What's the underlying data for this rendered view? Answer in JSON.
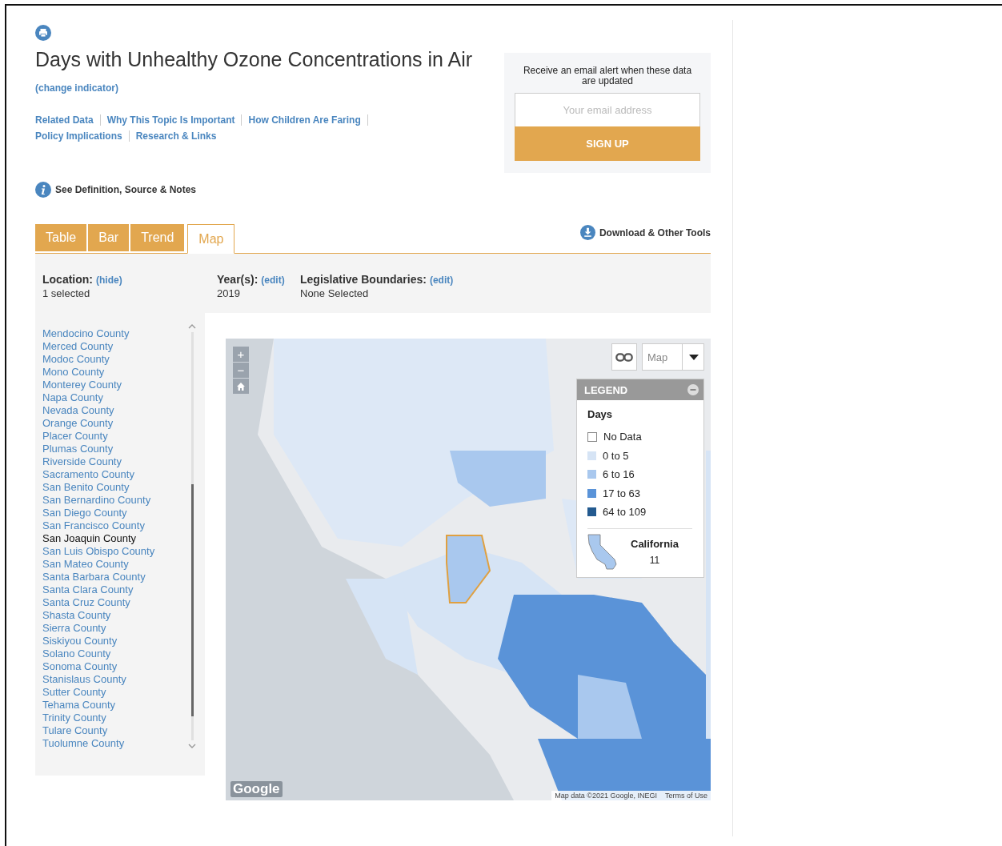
{
  "page": {
    "title": "Days with Unhealthy Ozone Concentrations in Air",
    "change_link": "(change indicator)",
    "nav_links": [
      "Related Data",
      "Why This Topic Is Important",
      "How Children Are Faring",
      "Policy Implications",
      "Research & Links"
    ],
    "definition_link": "See Definition, Source & Notes"
  },
  "alert_box": {
    "text": "Receive an email alert when these data are updated",
    "email": {
      "placeholder": "Your email address"
    },
    "button": "SIGN UP"
  },
  "tabs": [
    {
      "label": "Table",
      "selected": false
    },
    {
      "label": "Bar",
      "selected": false
    },
    {
      "label": "Trend",
      "selected": false
    },
    {
      "label": "Map",
      "selected": true
    }
  ],
  "tools_link": "Download & Other Tools",
  "filters": [
    {
      "label": "Location:",
      "action": "(hide)",
      "value": "1 selected"
    },
    {
      "label": "Year(s):",
      "action": "(edit)",
      "value": "2019"
    },
    {
      "label": "Legislative Boundaries:",
      "action": "(edit)",
      "value": "None Selected"
    }
  ],
  "locations": [
    {
      "name": "Mendocino County",
      "selected": false
    },
    {
      "name": "Merced County",
      "selected": false
    },
    {
      "name": "Modoc County",
      "selected": false
    },
    {
      "name": "Mono County",
      "selected": false
    },
    {
      "name": "Monterey County",
      "selected": false
    },
    {
      "name": "Napa County",
      "selected": false
    },
    {
      "name": "Nevada County",
      "selected": false
    },
    {
      "name": "Orange County",
      "selected": false
    },
    {
      "name": "Placer County",
      "selected": false
    },
    {
      "name": "Plumas County",
      "selected": false
    },
    {
      "name": "Riverside County",
      "selected": false
    },
    {
      "name": "Sacramento County",
      "selected": false
    },
    {
      "name": "San Benito County",
      "selected": false
    },
    {
      "name": "San Bernardino County",
      "selected": false
    },
    {
      "name": "San Diego County",
      "selected": false
    },
    {
      "name": "San Francisco County",
      "selected": false
    },
    {
      "name": "San Joaquin County",
      "selected": true
    },
    {
      "name": "San Luis Obispo County",
      "selected": false
    },
    {
      "name": "San Mateo County",
      "selected": false
    },
    {
      "name": "Santa Barbara County",
      "selected": false
    },
    {
      "name": "Santa Clara County",
      "selected": false
    },
    {
      "name": "Santa Cruz County",
      "selected": false
    },
    {
      "name": "Shasta County",
      "selected": false
    },
    {
      "name": "Sierra County",
      "selected": false
    },
    {
      "name": "Siskiyou County",
      "selected": false
    },
    {
      "name": "Solano County",
      "selected": false
    },
    {
      "name": "Sonoma County",
      "selected": false
    },
    {
      "name": "Stanislaus County",
      "selected": false
    },
    {
      "name": "Sutter County",
      "selected": false
    },
    {
      "name": "Tehama County",
      "selected": false
    },
    {
      "name": "Trinity County",
      "selected": false
    },
    {
      "name": "Tulare County",
      "selected": false
    },
    {
      "name": "Tuolumne County",
      "selected": false
    }
  ],
  "map": {
    "zoom_in": "+",
    "zoom_out": "−",
    "type_select": "Map",
    "legend": {
      "title": "LEGEND",
      "heading": "Days",
      "items": [
        {
          "label": "No Data",
          "color": "#ffffff"
        },
        {
          "label": "0 to 5",
          "color": "#d6e4f5"
        },
        {
          "label": "6 to 16",
          "color": "#a9c8ee"
        },
        {
          "label": "17 to 63",
          "color": "#5a93d8"
        },
        {
          "label": "64 to 109",
          "color": "#235a8f"
        }
      ],
      "state": "California",
      "state_value": "11"
    },
    "logo": "Google",
    "attribution": "Map data ©2021 Google, INEGI",
    "terms": "Terms of Use"
  }
}
